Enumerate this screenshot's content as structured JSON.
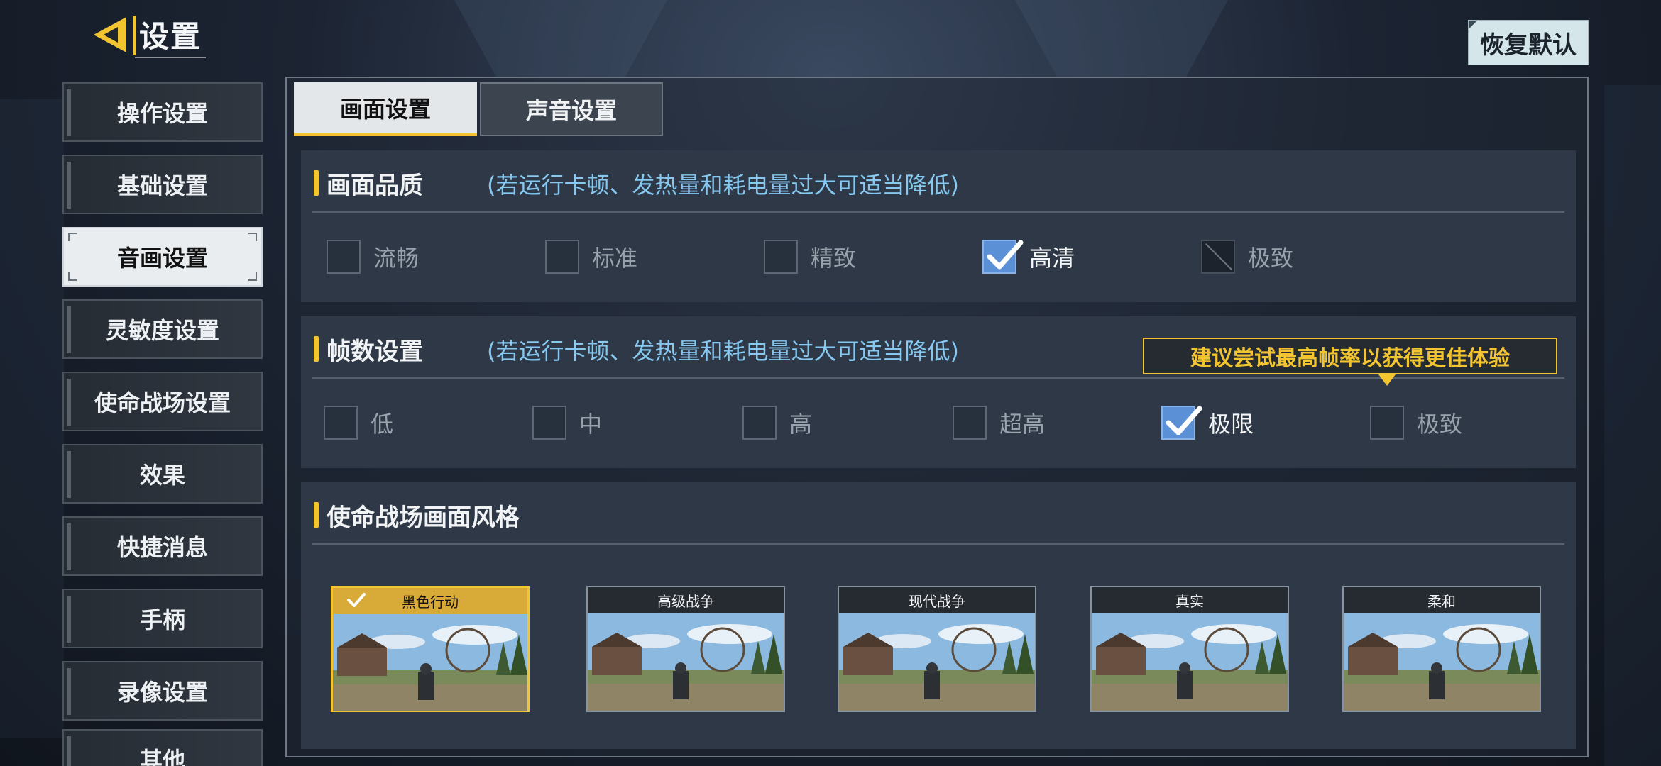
{
  "header": {
    "title": "设置",
    "reset_label": "恢复默认"
  },
  "sidebar": {
    "items": [
      {
        "label": "操作设置"
      },
      {
        "label": "基础设置"
      },
      {
        "label": "音画设置",
        "active": true
      },
      {
        "label": "灵敏度设置"
      },
      {
        "label": "使命战场设置"
      },
      {
        "label": "效果"
      },
      {
        "label": "快捷消息"
      },
      {
        "label": "手柄"
      },
      {
        "label": "录像设置"
      },
      {
        "label": "其他"
      }
    ]
  },
  "tabs": [
    {
      "label": "画面设置",
      "active": true
    },
    {
      "label": "声音设置"
    }
  ],
  "quality": {
    "title": "画面品质",
    "hint": "(若运行卡顿、发热量和耗电量过大可适当降低)",
    "options": [
      "流畅",
      "标准",
      "精致",
      "高清",
      "极致"
    ],
    "selected": "高清",
    "disabled": [
      "极致"
    ]
  },
  "framerate": {
    "title": "帧数设置",
    "hint": "(若运行卡顿、发热量和耗电量过大可适当降低)",
    "options": [
      "低",
      "中",
      "高",
      "超高",
      "极限",
      "极致"
    ],
    "selected": "极限",
    "tooltip": "建议尝试最高帧率以获得更佳体验"
  },
  "style": {
    "title": "使命战场画面风格",
    "cards": [
      "黑色行动",
      "高级战争",
      "现代战争",
      "真实",
      "柔和"
    ],
    "selected": "黑色行动"
  },
  "colors": {
    "accent": "#f2c530",
    "hint": "#86c8f0",
    "checked": "#5b8fd6"
  }
}
